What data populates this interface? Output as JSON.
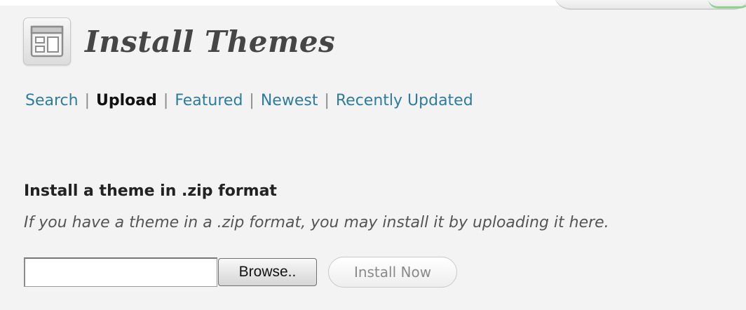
{
  "header": {
    "icon": "themes-layout-icon",
    "title": "Install Themes"
  },
  "subnav": {
    "items": [
      {
        "label": "Search",
        "current": false
      },
      {
        "label": "Upload",
        "current": true
      },
      {
        "label": "Featured",
        "current": false
      },
      {
        "label": "Newest",
        "current": false
      },
      {
        "label": "Recently Updated",
        "current": false
      }
    ],
    "separator": "|"
  },
  "upload": {
    "title": "Install a theme in .zip format",
    "description": "If you have a theme in a .zip format, you may install it by uploading it here.",
    "file_input_value": "",
    "browse_label": "Browse..",
    "install_label": "Install Now"
  },
  "colors": {
    "link": "#2e7c9c",
    "background": "#f3f3f3",
    "title_text": "#464646"
  }
}
